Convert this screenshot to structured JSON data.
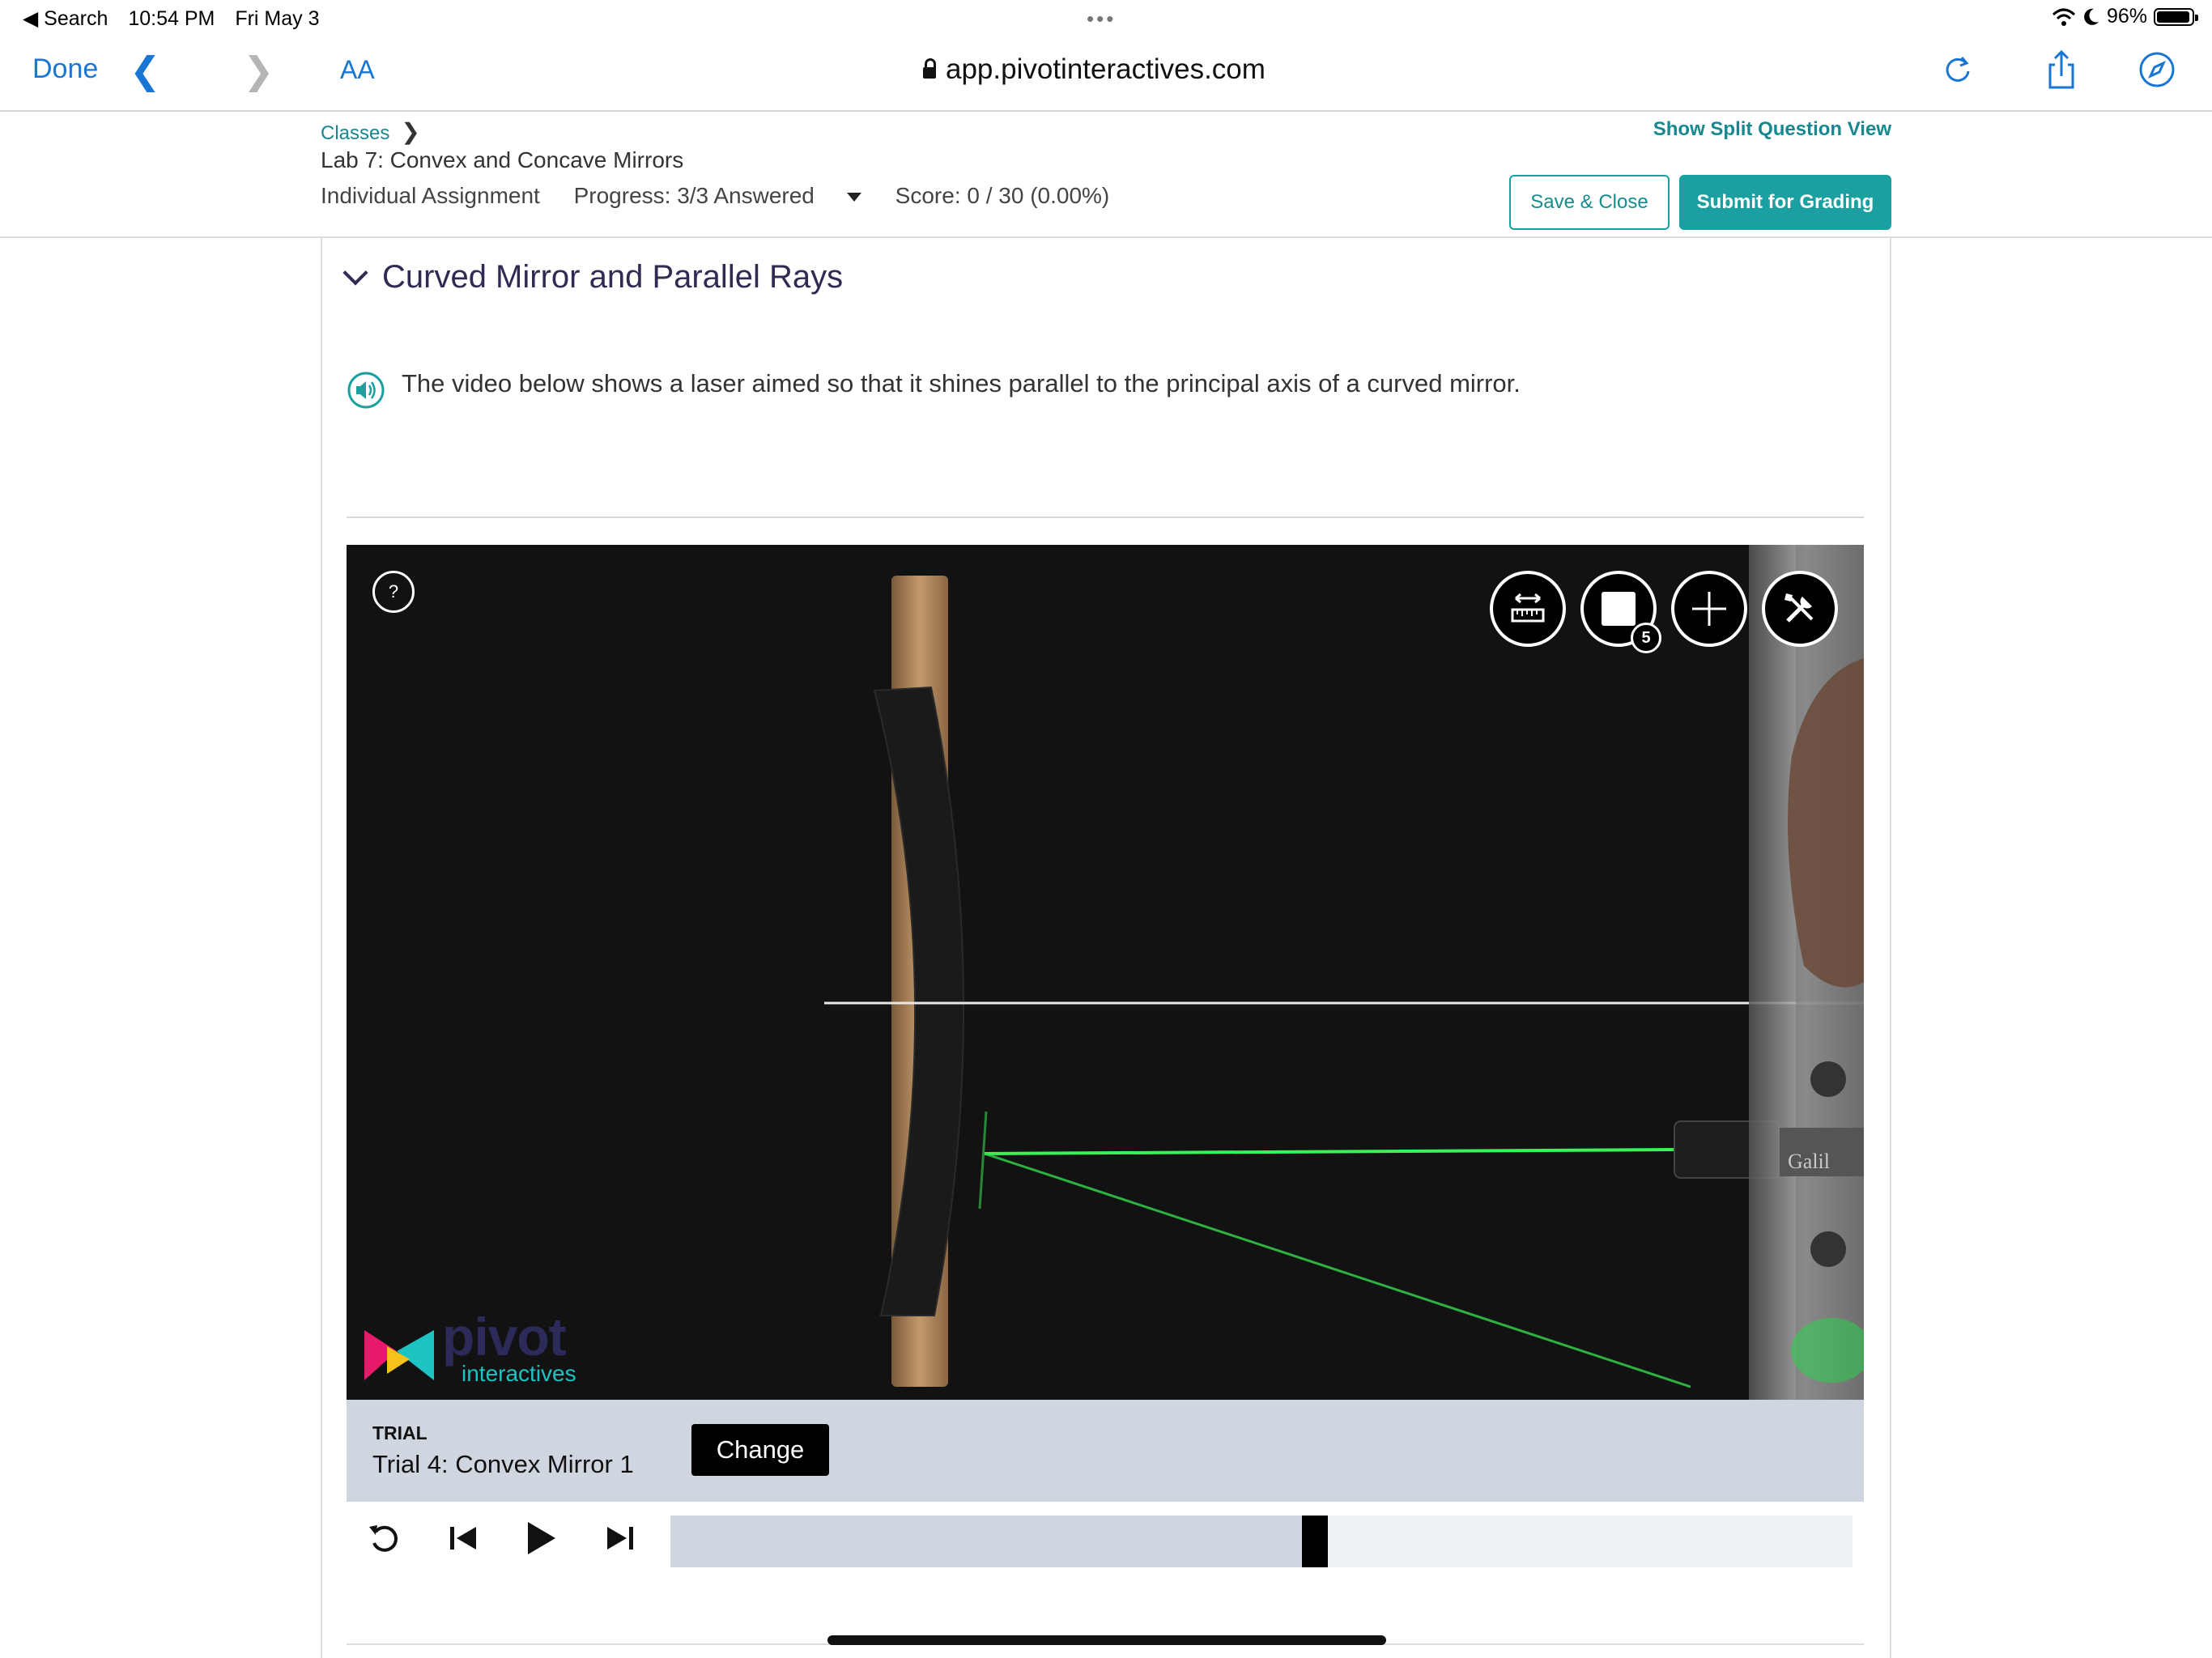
{
  "status_bar": {
    "back_app": "◀ Search",
    "time": "10:54 PM",
    "date": "Fri May 3",
    "battery": "96%",
    "battery_level": 0.96
  },
  "browser": {
    "done": "Done",
    "text_size": "AA",
    "url": "app.pivotinteractives.com"
  },
  "header": {
    "breadcrumb": "Classes",
    "assignment_title": "Lab 7: Convex and Concave Mirrors",
    "assignment_type": "Individual Assignment",
    "progress": "Progress: 3/3 Answered",
    "score": "Score: 0 / 30 (0.00%)",
    "split_view_link": "Show Split Question View",
    "save_close": "Save & Close",
    "submit": "Submit for Grading"
  },
  "section": {
    "title": "Curved Mirror and Parallel Rays",
    "prompt": "The video below shows a laser aimed so that it shines parallel to the principal axis of a curved mirror."
  },
  "video": {
    "help": "?",
    "tools": [
      {
        "icon": "ruler-icon"
      },
      {
        "icon": "box-icon",
        "badge": "5"
      },
      {
        "icon": "plus-icon"
      },
      {
        "icon": "tools-icon"
      }
    ],
    "watermark": {
      "word": "pivot",
      "sub": "interactives"
    },
    "equipment_label": "Galil"
  },
  "trial": {
    "label": "TRIAL",
    "name": "Trial 4: Convex Mirror 1",
    "change": "Change"
  },
  "playback": {
    "position": 0.545
  },
  "colors": {
    "accent": "#1aa0a0",
    "link": "#17888f",
    "title": "#2f2b52",
    "ios_blue": "#1976d2",
    "laser": "#3cff5a"
  }
}
